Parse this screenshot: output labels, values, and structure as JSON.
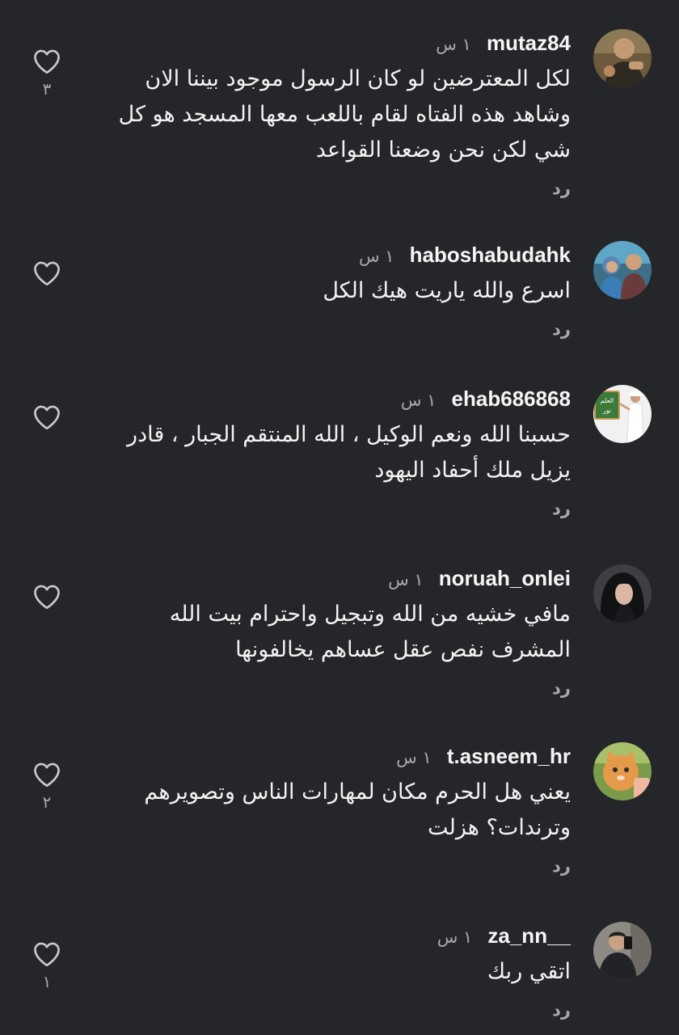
{
  "reply_label": "رد",
  "comments": [
    {
      "username": "mutaz84",
      "time": "١ س",
      "text": "لكل المعترضين لو كان الرسول موجود بيننا الان وشاهد هذه الفتاه لقام باللعب معها المسجد هو كل شي لكن نحن وضعنا القواعد",
      "likes": "٣"
    },
    {
      "username": "haboshabudahk",
      "time": "١ س",
      "text": "اسرع والله ياريت هيك الكل",
      "likes": ""
    },
    {
      "username": "ehab686868",
      "time": "١ س",
      "text": "حسبنا الله ونعم الوكيل ، الله المنتقم الجبار ، قادر يزيل ملك أحفاد اليهود",
      "avatar_text": "العلم نور",
      "likes": ""
    },
    {
      "username": "noruah_onlei",
      "time": "١ س",
      "text": "مافي خشيه من الله وتبجيل واحترام بيت الله المشرف نفص عقل عساهم يخالفونها",
      "likes": ""
    },
    {
      "username": "t.asneem_hr",
      "time": "١ س",
      "text": "يعني هل الحرم مكان لمهارات الناس وتصويرهم وترندات؟ هزلت",
      "likes": "٢"
    },
    {
      "username": "za_nn__",
      "time": "١ س",
      "text": "اتقي ربك",
      "likes": "١"
    }
  ],
  "colors": {
    "background": "#25262a",
    "primary_text": "#f3f3f4",
    "secondary_text": "#a8a9ad"
  },
  "icons": {
    "like": "heart-outline-icon"
  }
}
